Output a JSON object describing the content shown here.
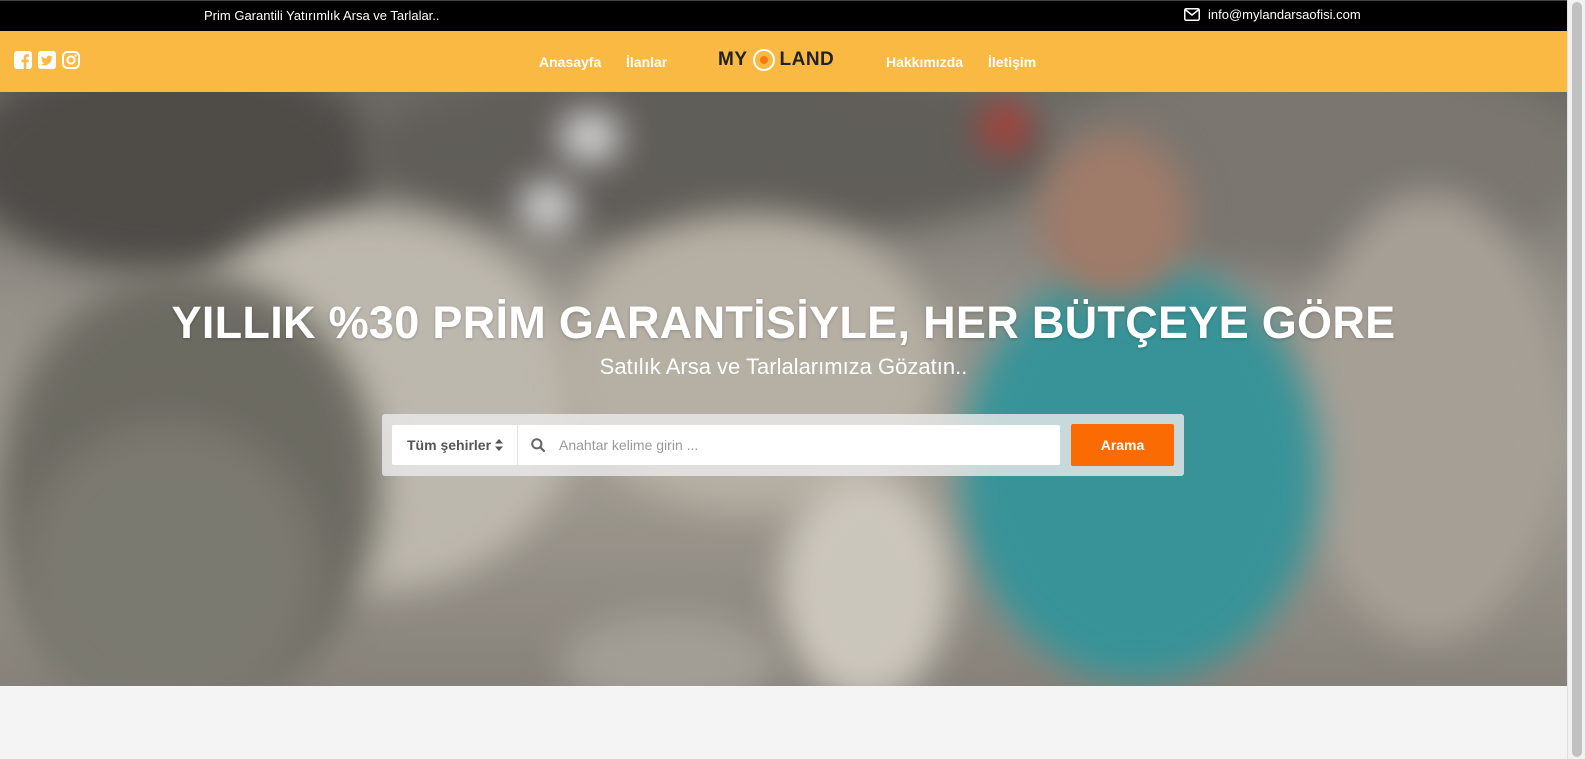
{
  "topbar": {
    "tagline": "Prim Garantili Yatırımlık Arsa ve Tarlalar..",
    "email_icon": "envelope-icon",
    "email": "info@mylandarsaofisi.com"
  },
  "social": {
    "icons": [
      "facebook-icon",
      "twitter-icon",
      "instagram-icon"
    ]
  },
  "nav": {
    "home": "Anasayfa",
    "listings": "İlanlar",
    "about": "Hakkımızda",
    "contact": "İletişim"
  },
  "logo": {
    "left": "MY",
    "right": "LAND",
    "icon": "location-pin-icon"
  },
  "hero": {
    "title": "YILLIK %30 PRİM GARANTİSİYLE, HER BÜTÇEYE GÖRE",
    "subtitle": "Satılık Arsa ve Tarlalarımıza Gözatın.."
  },
  "search": {
    "city_select_value": "Tüm şehirler",
    "keyword_placeholder": "Anahtar kelime girin ...",
    "button_label": "Arama"
  },
  "colors": {
    "topbar_bg": "#000000",
    "navbar_bg": "#fab942",
    "accent_button": "#fb6b04"
  }
}
